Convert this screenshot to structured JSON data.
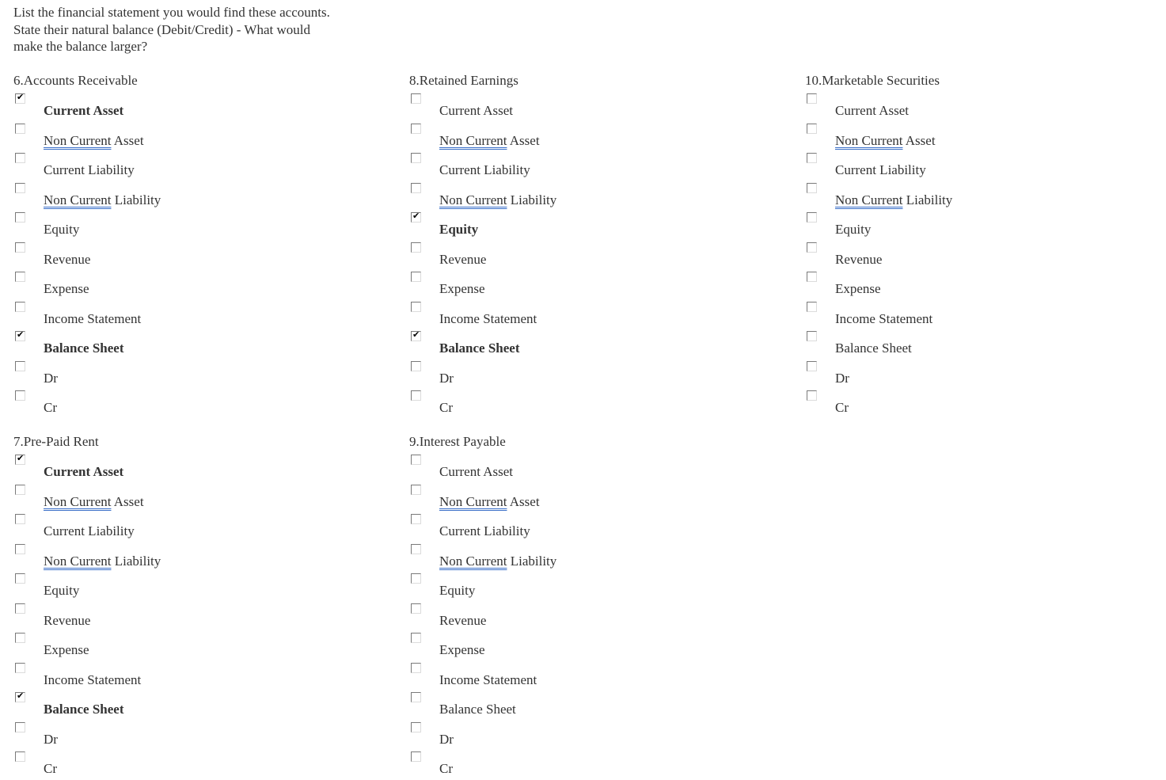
{
  "instructions": "List the financial statement you would find these accounts. State their natural balance (Debit/Credit) - What would make the balance larger?",
  "option_labels": [
    {
      "prefix": "",
      "rest": "Current Asset"
    },
    {
      "prefix": "Non Current",
      "rest": " Asset"
    },
    {
      "prefix": "",
      "rest": "Current Liability"
    },
    {
      "prefix": "Non Current",
      "rest": " Liability"
    },
    {
      "prefix": "",
      "rest": "Equity"
    },
    {
      "prefix": "",
      "rest": "Revenue"
    },
    {
      "prefix": "",
      "rest": "Expense"
    },
    {
      "prefix": "",
      "rest": "Income Statement"
    },
    {
      "prefix": "",
      "rest": "Balance Sheet"
    },
    {
      "prefix": "",
      "rest": "Dr"
    },
    {
      "prefix": "",
      "rest": "Cr"
    }
  ],
  "questions": [
    {
      "id": "q6",
      "title": "6.Accounts Receivable",
      "checked": [
        "Current Asset",
        "Balance Sheet"
      ]
    },
    {
      "id": "q7",
      "title": "7.Pre-Paid Rent",
      "checked": [
        "Current Asset",
        "Balance Sheet"
      ]
    },
    {
      "id": "q8",
      "title": "8.Retained Earnings",
      "checked": [
        "Equity",
        "Balance Sheet"
      ]
    },
    {
      "id": "q9",
      "title": "9.Interest Payable",
      "checked": []
    },
    {
      "id": "q10",
      "title": "10.Marketable Securities",
      "checked": []
    }
  ],
  "checkmark_glyph": "✔"
}
